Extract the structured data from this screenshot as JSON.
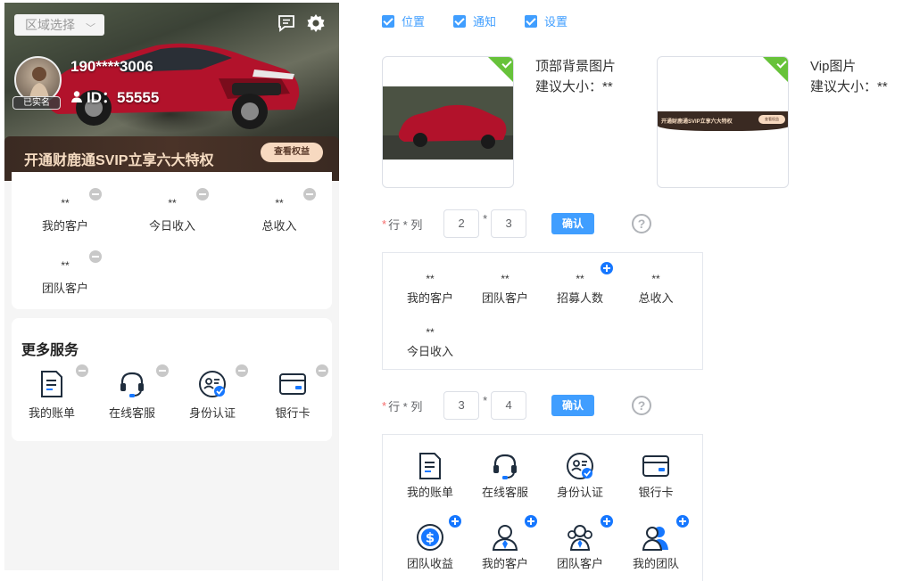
{
  "preview": {
    "region_select": "区域选择",
    "phone": "190****3006",
    "user_id": "ID：55555",
    "verified_tag": "已实名",
    "vip_banner_text": "开通财鹿通SVIP立享六大特权",
    "vip_button": "查看权益",
    "stats": [
      {
        "value": "**",
        "label": "我的客户"
      },
      {
        "value": "**",
        "label": "今日收入"
      },
      {
        "value": "**",
        "label": "总收入"
      },
      {
        "value": "**",
        "label": "团队客户"
      }
    ],
    "services_title": "更多服务",
    "services": [
      {
        "label": "我的账单",
        "icon": "bill-icon"
      },
      {
        "label": "在线客服",
        "icon": "headset-icon"
      },
      {
        "label": "身份认证",
        "icon": "id-verify-icon"
      },
      {
        "label": "银行卡",
        "icon": "bank-card-icon"
      }
    ]
  },
  "config": {
    "checkboxes": [
      {
        "label": "位置",
        "checked": true
      },
      {
        "label": "通知",
        "checked": true
      },
      {
        "label": "设置",
        "checked": true
      }
    ],
    "top_bg": {
      "title": "顶部背景图片",
      "hint": "建议大小：**"
    },
    "vip_img": {
      "title": "Vip图片",
      "hint": "建议大小：**",
      "banner_text": "开通财鹿通SVIP立享六大特权",
      "banner_btn": "查看权益"
    },
    "grid1": {
      "label": "行 * 列",
      "rows": "2",
      "cols": "3",
      "times": "*",
      "confirm": "确认",
      "help": "?",
      "items": [
        {
          "value": "**",
          "label": "我的客户"
        },
        {
          "value": "**",
          "label": "团队客户"
        },
        {
          "value": "**",
          "label": "招募人数"
        },
        {
          "value": "**",
          "label": "总收入"
        },
        {
          "value": "**",
          "label": "今日收入"
        }
      ]
    },
    "grid2": {
      "label": "行 * 列",
      "rows": "3",
      "cols": "4",
      "times": "*",
      "confirm": "确认",
      "help": "?",
      "items": [
        {
          "label": "我的账单",
          "icon": "bill-icon"
        },
        {
          "label": "在线客服",
          "icon": "headset-icon"
        },
        {
          "label": "身份认证",
          "icon": "id-verify-icon"
        },
        {
          "label": "银行卡",
          "icon": "bank-card-icon"
        },
        {
          "label": "团队收益",
          "icon": "dollar-coin-icon"
        },
        {
          "label": "我的客户",
          "icon": "customer-icon"
        },
        {
          "label": "团队客户",
          "icon": "team-customer-icon"
        },
        {
          "label": "我的团队",
          "icon": "my-team-icon"
        }
      ]
    }
  },
  "colors": {
    "primary": "#409eff",
    "success": "#67c23a",
    "danger": "#f56c6c",
    "vip_gold": "#f6dcc2"
  }
}
